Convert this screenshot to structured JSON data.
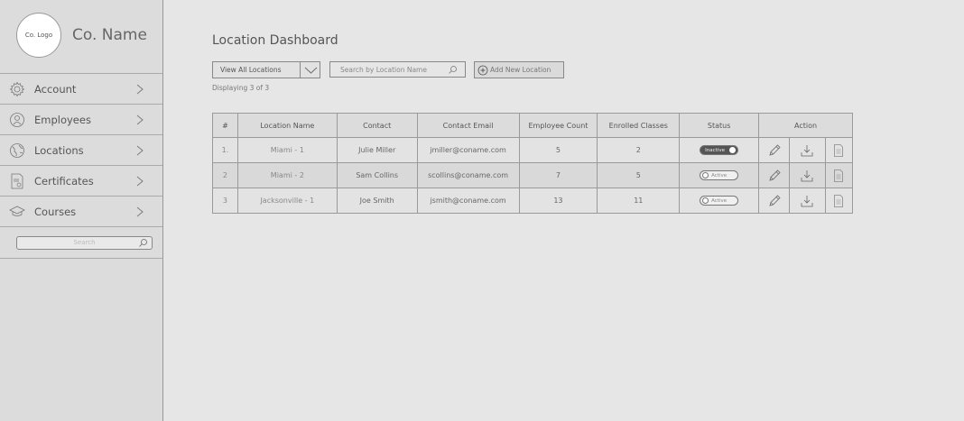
{
  "sidebar": {
    "logo": "Co. Logo",
    "company_name": "Co. Name",
    "items": [
      {
        "label": "Account",
        "icon": "gear-icon"
      },
      {
        "label": "Employees",
        "icon": "user-icon"
      },
      {
        "label": "Locations",
        "icon": "globe-icon"
      },
      {
        "label": "Certificates",
        "icon": "certificate-icon"
      },
      {
        "label": "Courses",
        "icon": "graduation-cap-icon"
      }
    ],
    "search_placeholder": "Search"
  },
  "main": {
    "title": "Location Dashboard",
    "filter_select": "View All Locations",
    "search_placeholder": "Search by Location Name",
    "add_button": "Add New Location",
    "displaying": "Displaying 3 of 3"
  },
  "table": {
    "headers": [
      "#",
      "Location Name",
      "Contact",
      "Contact Email",
      "Employee Count",
      "Enrolled Classes",
      "Status",
      "Action"
    ],
    "rows": [
      {
        "num": "1.",
        "location": "Miami - 1",
        "contact": "Julie Miller",
        "email": "jmiller@coname.com",
        "employees": "5",
        "classes": "2",
        "status": "Inactive"
      },
      {
        "num": "2",
        "location": "Miami - 2",
        "contact": "Sam Collins",
        "email": "scollins@coname.com",
        "employees": "7",
        "classes": "5",
        "status": "Active"
      },
      {
        "num": "3",
        "location": "Jacksonville - 1",
        "contact": "Joe Smith",
        "email": "jsmith@coname.com",
        "employees": "13",
        "classes": "11",
        "status": "Active"
      }
    ]
  },
  "colors": {
    "background": "#e6e6e6",
    "sidebar": "#dcdcdc",
    "border": "#9a9a9a",
    "toggle_inactive": "#555555"
  }
}
